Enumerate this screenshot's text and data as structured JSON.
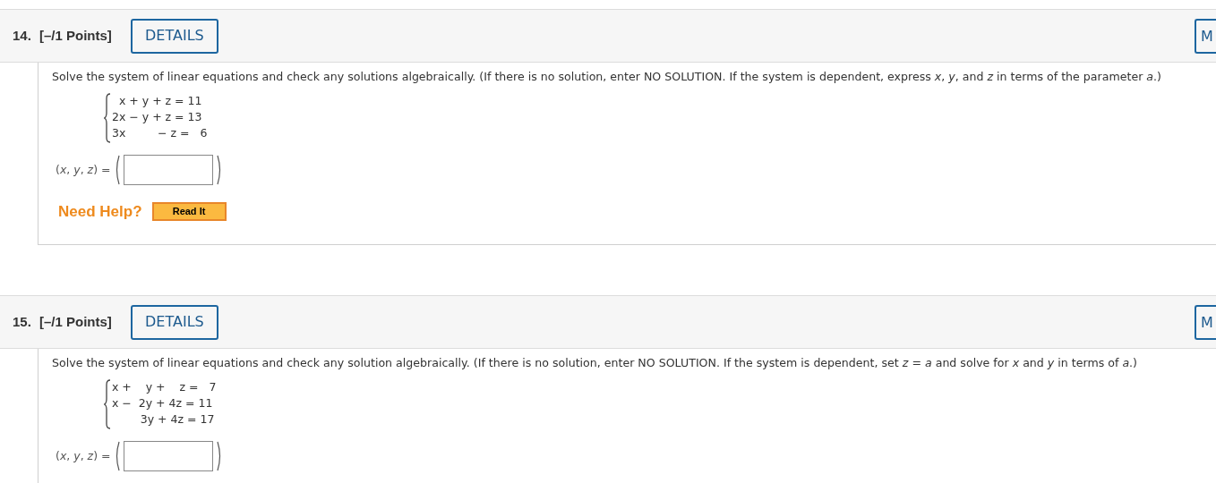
{
  "questions": [
    {
      "number": "14.",
      "points": "[–/1 Points]",
      "details_button": "DETAILS",
      "side_button": "M",
      "prompt": "Solve the system of linear equations and check any solutions algebraically. (If there is no solution, enter NO SOLUTION. If the system is dependent, express *x*, *y*, and *z* in terms of the parameter *a*.)",
      "equations": [
        "  x + y + z = 11",
        "2x − y + z = 13",
        "3x         − z =   6"
      ],
      "answer_label": "(*x*, *y*, *z*) =",
      "help": {
        "label": "Need Help?",
        "button": "Read It"
      }
    },
    {
      "number": "15.",
      "points": "[–/1 Points]",
      "details_button": "DETAILS",
      "side_button": "M",
      "prompt": "Solve the system of linear equations and check any solution algebraically. (If there is no solution, enter NO SOLUTION. If the system is dependent, set *z* = *a* and solve for *x* and *y* in terms of *a*.)",
      "equations": [
        "x +    y +    z =   7",
        "x −  2y + 4z = 11",
        "        3y + 4z = 17"
      ],
      "answer_label": "(*x*, *y*, *z*) ="
    }
  ]
}
